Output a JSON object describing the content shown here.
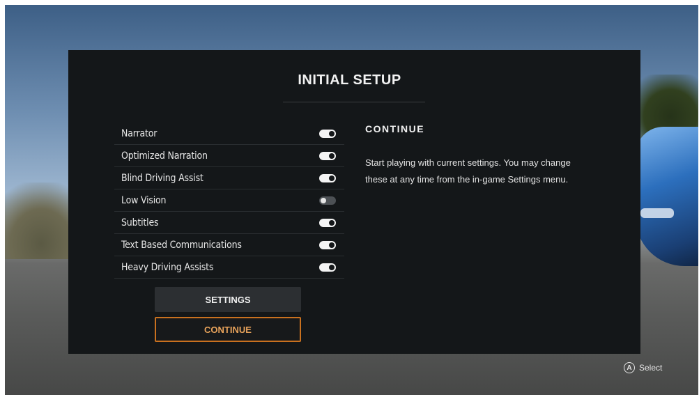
{
  "header": {
    "title": "INITIAL SETUP"
  },
  "settings": [
    {
      "label": "Narrator",
      "enabled": true
    },
    {
      "label": "Optimized Narration",
      "enabled": true
    },
    {
      "label": "Blind Driving Assist",
      "enabled": true
    },
    {
      "label": "Low Vision",
      "enabled": false
    },
    {
      "label": "Subtitles",
      "enabled": true
    },
    {
      "label": "Text Based Communications",
      "enabled": true
    },
    {
      "label": "Heavy Driving Assists",
      "enabled": true
    }
  ],
  "buttons": {
    "settings_label": "SETTINGS",
    "continue_label": "CONTINUE"
  },
  "info": {
    "title": "CONTINUE",
    "description": "Start playing with current settings. You may change these at any time from the in-game Settings menu."
  },
  "hint": {
    "button_glyph": "A",
    "label": "Select"
  },
  "colors": {
    "accent": "#c9711f",
    "panel": "#141719"
  }
}
